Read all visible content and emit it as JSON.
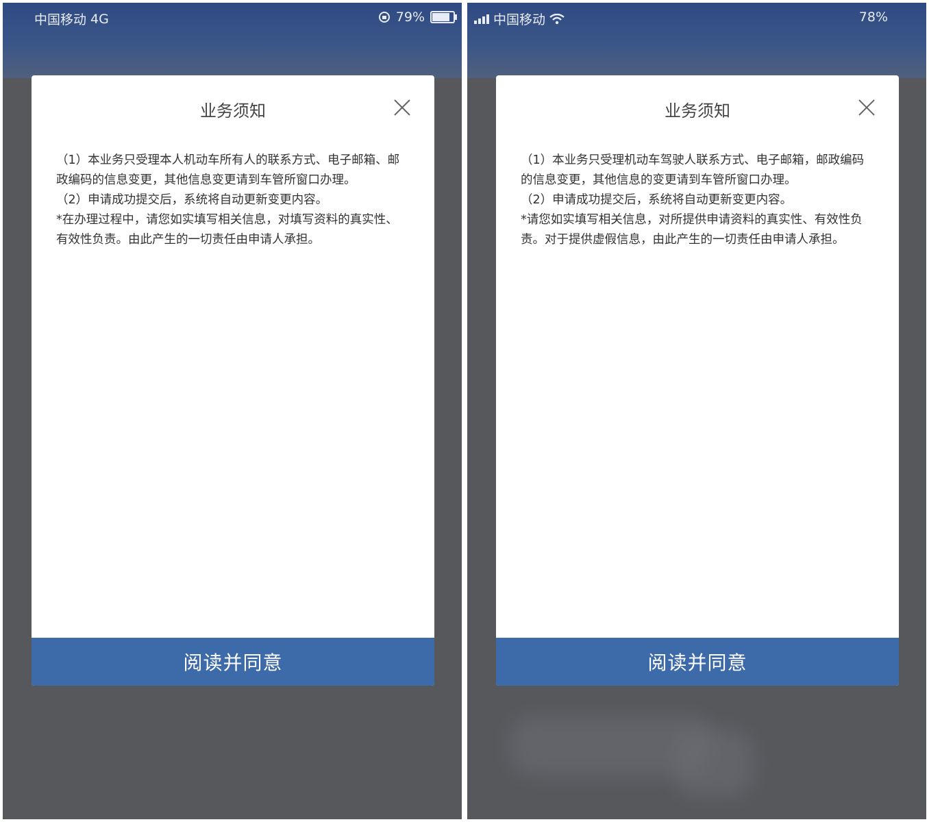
{
  "left": {
    "status": {
      "carrier": "中国移动",
      "network": "4G",
      "battery_text": "79%",
      "battery_level": 0.79
    },
    "modal": {
      "title": "业务须知",
      "paragraphs": [
        "（1）本业务只受理本人机动车所有人的联系方式、电子邮箱、邮政编码的信息变更，其他信息变更请到车管所窗口办理。",
        "（2）申请成功提交后，系统将自动更新变更内容。",
        "*在办理过程中，请您如实填写相关信息，对填写资料的真实性、有效性负责。由此产生的一切责任由申请人承担。"
      ],
      "agree_label": "阅读并同意"
    }
  },
  "right": {
    "status": {
      "carrier": "中国移动",
      "battery_text": "78%"
    },
    "modal": {
      "title": "业务须知",
      "paragraphs": [
        "（1）本业务只受理机动车驾驶人联系方式、电子邮箱，邮政编码的信息变更，其他信息的变更请到车管所窗口办理。",
        "（2）申请成功提交后，系统将自动更新变更内容。",
        "*请您如实填写相关信息，对所提供申请资料的真实性、有效性负责。对于提供虚假信息，由此产生的一切责任由申请人承担。"
      ],
      "agree_label": "阅读并同意"
    }
  },
  "colors": {
    "button": "#3d6aa9",
    "overlay": "#57585c",
    "header": "#2e4a82"
  },
  "icons": [
    "close-icon",
    "signal-icon",
    "wifi-icon",
    "rotation-lock-icon",
    "battery-icon"
  ]
}
